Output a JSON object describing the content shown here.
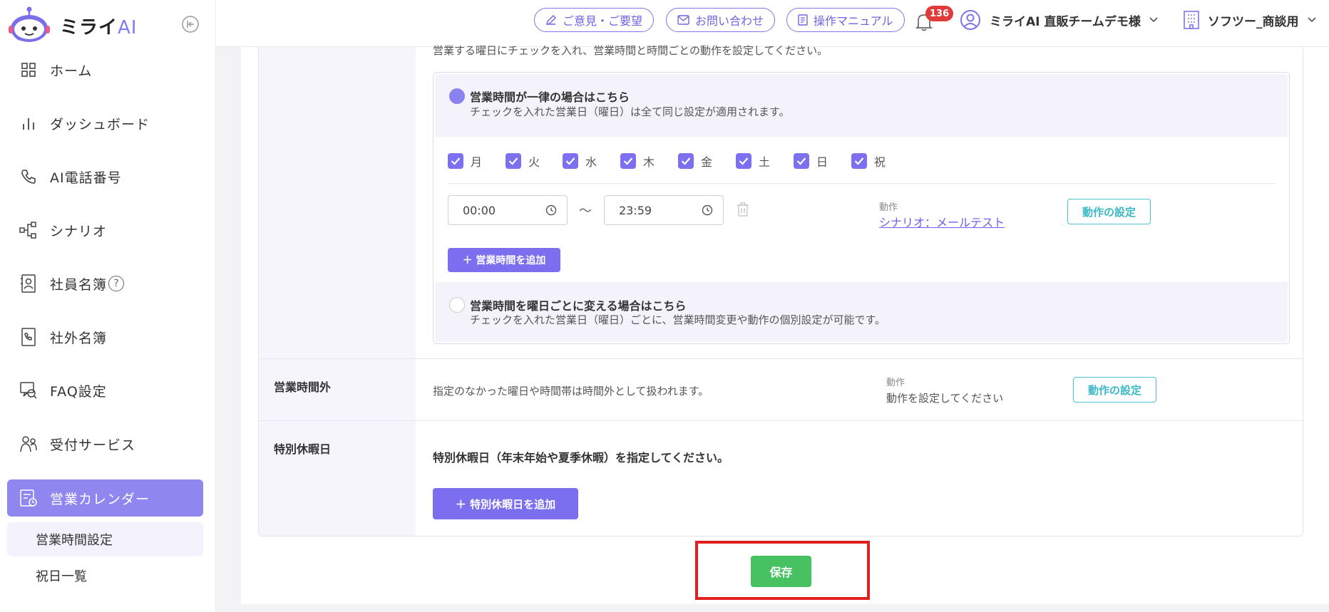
{
  "brand": {
    "name": "ミライ",
    "ai": "AI"
  },
  "sidebar": {
    "items": [
      {
        "label": "ホーム",
        "icon": "grid-icon"
      },
      {
        "label": "ダッシュボード",
        "icon": "bar-chart-icon"
      },
      {
        "label": "AI電話番号",
        "icon": "phone-icon"
      },
      {
        "label": "シナリオ",
        "icon": "flow-icon"
      },
      {
        "label": "社員名簿",
        "icon": "contact-book-icon",
        "help": "?"
      },
      {
        "label": "社外名簿",
        "icon": "phone-book-icon"
      },
      {
        "label": "FAQ設定",
        "icon": "faq-icon"
      },
      {
        "label": "受付サービス",
        "icon": "people-icon"
      },
      {
        "label": "営業カレンダー",
        "icon": "calendar-clock-icon",
        "active": true
      }
    ],
    "subitems": [
      {
        "label": "営業時間設定",
        "active": true
      },
      {
        "label": "祝日一覧"
      }
    ]
  },
  "header": {
    "feedback": "ご意見・ご要望",
    "contact": "お問い合わせ",
    "manual": "操作マニュアル",
    "notifications": "136",
    "user": "ミライAI 直販チームデモ様",
    "company": "ソフツー_商談用"
  },
  "business_hours": {
    "intro": "営業する曜日にチェックを入れ、営業時間と時間ごとの動作を設定してください。",
    "uniform": {
      "title": "営業時間が一律の場合はこちら",
      "desc": "チェックを入れた営業日（曜日）は全て同じ設定が適用されます。",
      "selected": true
    },
    "days": [
      {
        "label": "月",
        "checked": true
      },
      {
        "label": "火",
        "checked": true
      },
      {
        "label": "水",
        "checked": true
      },
      {
        "label": "木",
        "checked": true
      },
      {
        "label": "金",
        "checked": true
      },
      {
        "label": "土",
        "checked": true
      },
      {
        "label": "日",
        "checked": true
      },
      {
        "label": "祝",
        "checked": true
      }
    ],
    "start": "00:00",
    "tilde": "〜",
    "end": "23:59",
    "action_label": "動作",
    "action_value": "シナリオ：メールテスト",
    "action_button": "動作の設定",
    "add_hours": "＋ 営業時間を追加",
    "per_day": {
      "title": "営業時間を曜日ごとに変える場合はこちら",
      "desc": "チェックを入れた営業日（曜日）ごとに、営業時間変更や動作の個別設定が可能です。",
      "selected": false
    }
  },
  "after_hours": {
    "label": "営業時間外",
    "desc": "指定のなかった曜日や時間帯は時間外として扱われます。",
    "action_label": "動作",
    "action_value": "動作を設定してください",
    "action_button": "動作の設定"
  },
  "special_holidays": {
    "label": "特別休暇日",
    "desc": "特別休暇日（年末年始や夏季休暇）を指定してください。",
    "add_button": "＋ 特別休暇日を追加"
  },
  "save_label": "保存",
  "colors": {
    "accent": "#7b6ff0",
    "save": "#48c163",
    "teal": "#3cb9c6",
    "badge": "#e03b3b",
    "highlight": "#e0201f"
  }
}
